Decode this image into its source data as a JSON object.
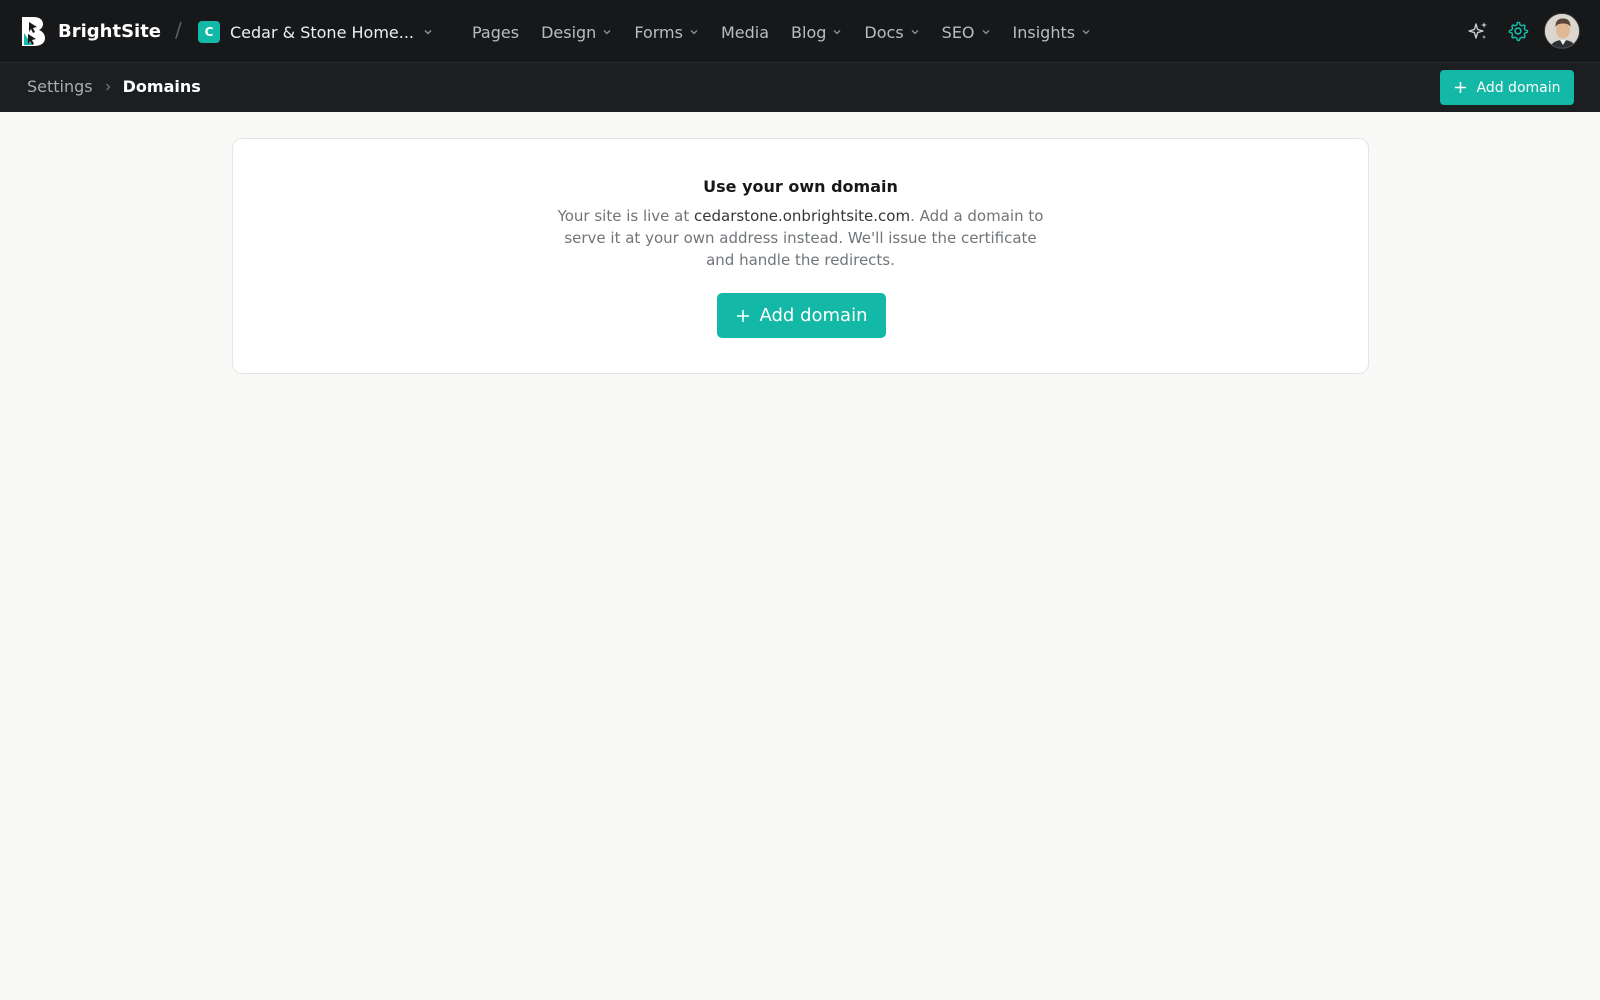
{
  "brand": {
    "name": "BrightSite",
    "accent": "#14b8a6"
  },
  "header": {
    "separator": "/",
    "site": {
      "initial": "C",
      "name": "Cedar & Stone Home..."
    },
    "nav": [
      {
        "label": "Pages",
        "has_menu": false
      },
      {
        "label": "Design",
        "has_menu": true
      },
      {
        "label": "Forms",
        "has_menu": true
      },
      {
        "label": "Media",
        "has_menu": false
      },
      {
        "label": "Blog",
        "has_menu": true
      },
      {
        "label": "Docs",
        "has_menu": true
      },
      {
        "label": "SEO",
        "has_menu": true
      },
      {
        "label": "Insights",
        "has_menu": true
      }
    ],
    "icons": [
      "sparkles-icon",
      "gear-icon",
      "avatar"
    ]
  },
  "breadcrumb": {
    "parent": "Settings",
    "current": "Domains"
  },
  "toolbar": {
    "add_domain_label": "Add domain"
  },
  "empty_state": {
    "title": "Use your own domain",
    "desc_before": "Your site is live at ",
    "desc_domain": "cedarstone.onbrightsite.com",
    "desc_after": ". Add a domain to serve it at your own address instead. We'll issue the certificate and handle the redirects.",
    "button_label": "Add domain"
  }
}
